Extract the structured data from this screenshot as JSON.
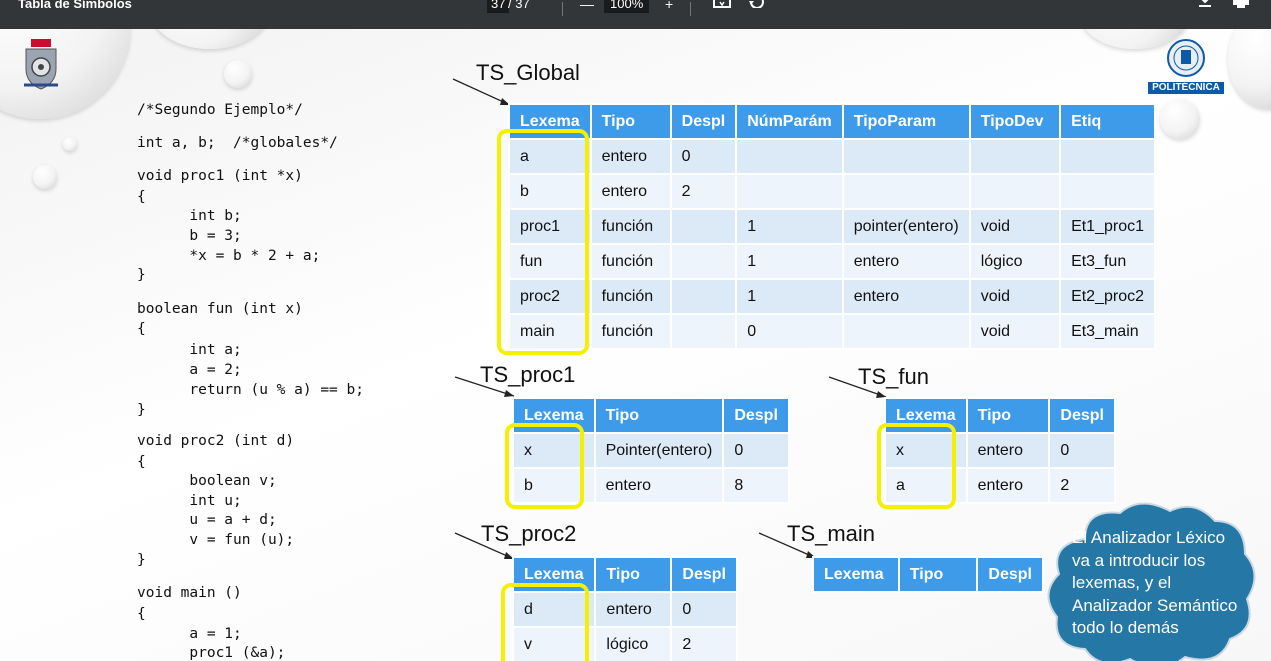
{
  "toolbar": {
    "title": "Tabla de Símbolos",
    "page_current": "37",
    "page_total": "/ 37",
    "zoom": "100%",
    "minus_label": "—",
    "plus_label": "+"
  },
  "logos": {
    "upm_label": "POLITÉCNICA"
  },
  "code": {
    "lines": [
      "/*Segundo Ejemplo*/",
      "int a, b;  /*globales*/",
      "void proc1 (int *x)",
      "{",
      "      int b;",
      "      b = 3;",
      "      *x = b * 2 + a;",
      "}",
      "boolean fun (int x)",
      "{",
      "      int a;",
      "      a = 2;",
      "      return (u % a) == b;",
      "}",
      "void proc2 (int d)",
      "{",
      "      boolean v;",
      "      int u;",
      "      u = a + d;",
      "      v = fun (u);",
      "}",
      "void main ()",
      "{",
      "      a = 1;",
      "      proc1 (&a);"
    ]
  },
  "ts_global": {
    "label": "TS_Global",
    "headers": [
      "Lexema",
      "Tipo",
      "Despl",
      "NúmParám",
      "TipoParam",
      "TipoDev",
      "Etiq"
    ],
    "rows": [
      [
        "a",
        "entero",
        "0",
        "",
        "",
        "",
        ""
      ],
      [
        "b",
        "entero",
        "2",
        "",
        "",
        "",
        ""
      ],
      [
        "proc1",
        "función",
        "",
        "1",
        "pointer(entero)",
        "void",
        "Et1_proc1"
      ],
      [
        "fun",
        "función",
        "",
        "1",
        "entero",
        "lógico",
        "Et3_fun"
      ],
      [
        "proc2",
        "función",
        "",
        "1",
        "entero",
        "void",
        "Et2_proc2"
      ],
      [
        "main",
        "función",
        "",
        "0",
        "",
        "void",
        "Et3_main"
      ]
    ]
  },
  "ts_proc1": {
    "label": "TS_proc1",
    "headers": [
      "Lexema",
      "Tipo",
      "Despl"
    ],
    "rows": [
      [
        "x",
        "Pointer(entero)",
        "0"
      ],
      [
        "b",
        "entero",
        "8"
      ]
    ]
  },
  "ts_fun": {
    "label": "TS_fun",
    "headers": [
      "Lexema",
      "Tipo",
      "Despl"
    ],
    "rows": [
      [
        "x",
        "entero",
        "0"
      ],
      [
        "a",
        "entero",
        "2"
      ]
    ]
  },
  "ts_proc2": {
    "label": "TS_proc2",
    "headers": [
      "Lexema",
      "Tipo",
      "Despl"
    ],
    "rows": [
      [
        "d",
        "entero",
        "0"
      ],
      [
        "v",
        "lógico",
        "2"
      ]
    ]
  },
  "ts_main": {
    "label": "TS_main",
    "headers": [
      "Lexema",
      "Tipo",
      "Despl"
    ]
  },
  "callout": {
    "lines": [
      "El Analizador Léxico",
      "va a introducir los",
      "lexemas, y el",
      "Analizador Semántico",
      "todo lo demás"
    ]
  }
}
